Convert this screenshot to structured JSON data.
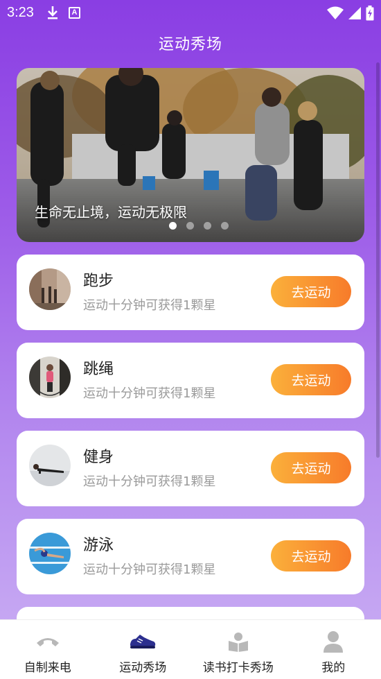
{
  "status_bar": {
    "time": "3:23",
    "keyboard_badge": "A"
  },
  "header": {
    "title": "运动秀场"
  },
  "banner": {
    "caption": "生命无止境，运动无极限",
    "page_count": 4,
    "active_page": 1
  },
  "cards": [
    {
      "title": "跑步",
      "subtitle": "运动十分钟可获得1颗星",
      "button": "去运动"
    },
    {
      "title": "跳绳",
      "subtitle": "运动十分钟可获得1颗星",
      "button": "去运动"
    },
    {
      "title": "健身",
      "subtitle": "运动十分钟可获得1颗星",
      "button": "去运动"
    },
    {
      "title": "游泳",
      "subtitle": "运动十分钟可获得1颗星",
      "button": "去运动"
    }
  ],
  "tabs": [
    {
      "label": "自制来电",
      "icon": "phone-icon"
    },
    {
      "label": "运动秀场",
      "icon": "sneaker-icon",
      "active": true
    },
    {
      "label": "读书打卡秀场",
      "icon": "book-icon"
    },
    {
      "label": "我的",
      "icon": "person-icon"
    }
  ],
  "colors": {
    "accent": "#8a3ee3",
    "button_start": "#fbb03b",
    "button_end": "#f77b2a",
    "active_tab": "#2c2f8f"
  }
}
